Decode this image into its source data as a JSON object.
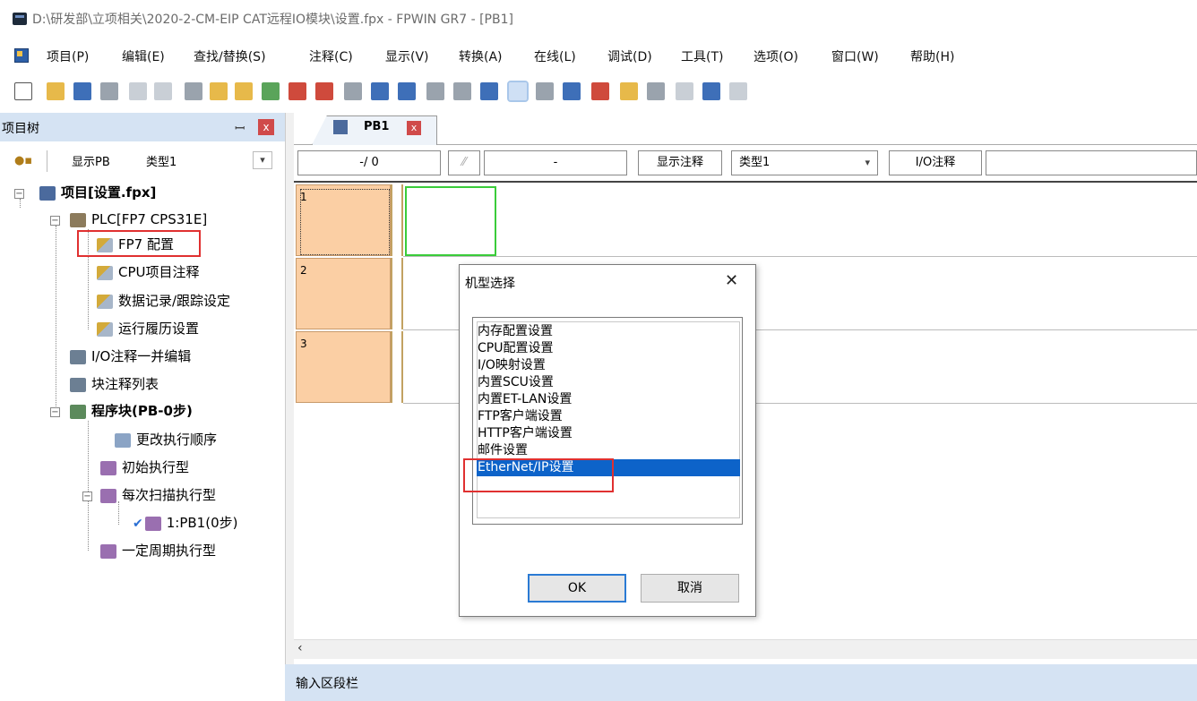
{
  "window": {
    "title": "D:\\研发部\\立项相关\\2020-2-CM-EIP CAT远程IO模块\\设置.fpx - FPWIN GR7 - [PB1]"
  },
  "menu": [
    "项目(P)",
    "编辑(E)",
    "查找/替换(S)",
    "注释(C)",
    "显示(V)",
    "转换(A)",
    "在线(L)",
    "调试(D)",
    "工具(T)",
    "选项(O)",
    "窗口(W)",
    "帮助(H)"
  ],
  "toolbar_icons": [
    "new-icon",
    "open-icon",
    "save-icon",
    "print-icon",
    "undo-icon",
    "redo-icon",
    "cut-icon",
    "copy-icon",
    "paste-icon",
    "insert-row-icon",
    "delete-row-icon",
    "replace-icon",
    "find-icon",
    "io-comment-icon",
    "block-comment-icon",
    "monitor-icon",
    "compile-icon",
    "convert-icon",
    "online-icon",
    "offline-icon",
    "upload-icon",
    "download-icon",
    "run-prog-icon",
    "stop-icon",
    "run-icon",
    "status-icon",
    "more-icon"
  ],
  "project_tree": {
    "title": "项目树",
    "pin_glyph": "ꟷ",
    "close_glyph": "x",
    "show_pb": "显示PB",
    "type": "类型1",
    "items": [
      "项目[设置.fpx]",
      "PLC[FP7 CPS31E]",
      "FP7 配置",
      "CPU项目注释",
      "数据记录/跟踪设定",
      "运行履历设置",
      "I/O注释一并编辑",
      "块注释列表",
      "程序块(PB-0步)",
      "更改执行顺序",
      "初始执行型",
      "每次扫描执行型",
      "1:PB1(0步)",
      "一定周期执行型"
    ]
  },
  "editor": {
    "tab_label": "PB1",
    "tab_close": "x",
    "position": "-/   0",
    "dash": "-",
    "show_comment": "显示注释",
    "type_select": "类型1",
    "io_comment": "I/O注释",
    "rungs": [
      "1",
      "2",
      "3"
    ]
  },
  "dialog": {
    "title": "机型选择",
    "close_glyph": "✕",
    "options": [
      "内存配置设置",
      "CPU配置设置",
      "I/O映射设置",
      "内置SCU设置",
      "内置ET-LAN设置",
      "FTP客户端设置",
      "HTTP客户端设置",
      "邮件设置",
      "EtherNet/IP设置"
    ],
    "selected_option": "EtherNet/IP设置",
    "ok": "OK",
    "cancel": "取消"
  },
  "statusbar": {
    "text": "输入区段栏"
  },
  "colors": {
    "rung_number_bg": "#fbcfa4",
    "selection": "#0d63c9",
    "highlight_box": "#e03030",
    "cursor": "#3acc3a",
    "panel_header": "#d5e3f3"
  }
}
